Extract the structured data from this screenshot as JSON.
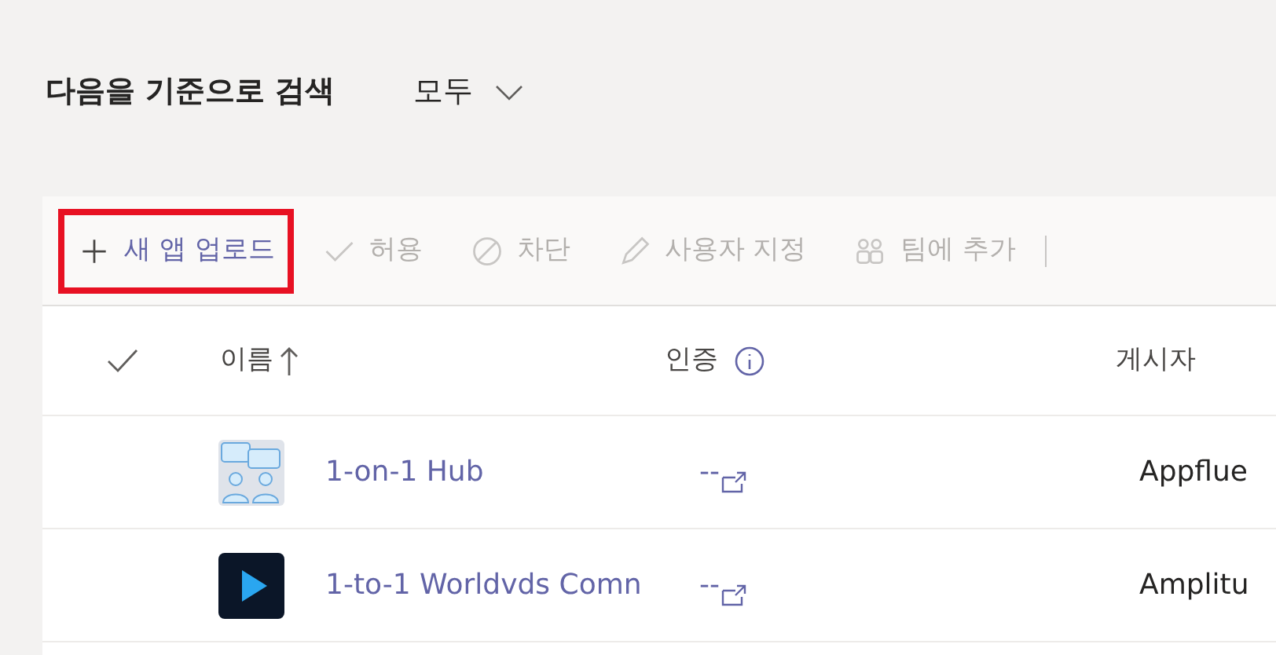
{
  "filter": {
    "label": "다음을 기준으로 검색",
    "value": "모두"
  },
  "toolbar": [
    {
      "kind": "upload",
      "label": "새 앱 업로드",
      "disabled": false,
      "highlighted": true
    },
    {
      "kind": "allow",
      "label": "허용",
      "disabled": true,
      "highlighted": false
    },
    {
      "kind": "block",
      "label": "차단",
      "disabled": true,
      "highlighted": false
    },
    {
      "kind": "customize",
      "label": "사용자 지정",
      "disabled": true,
      "highlighted": false
    },
    {
      "kind": "team",
      "label": "팀에 추가",
      "disabled": true,
      "highlighted": false
    }
  ],
  "table": {
    "columns": [
      "이름",
      "인증",
      "게시자"
    ],
    "rows": [
      {
        "kind": "chat",
        "name": "1-on-1 Hub",
        "certification": "--",
        "publisher": "Appflue"
      },
      {
        "kind": "play",
        "name": "1-to-1 Worldvds Comn",
        "certification": "--",
        "publisher": "Amplitu"
      }
    ]
  }
}
